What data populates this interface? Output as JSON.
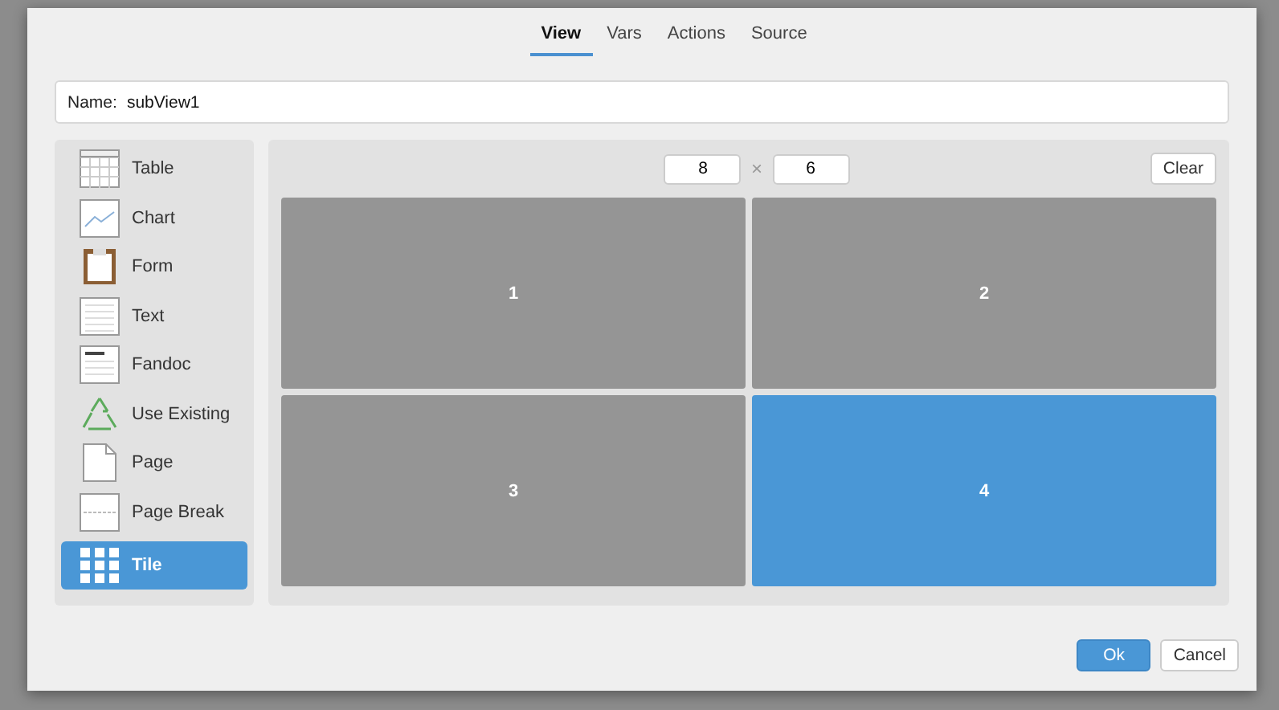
{
  "tabs": [
    {
      "label": "View",
      "selected": true
    },
    {
      "label": "Vars",
      "selected": false
    },
    {
      "label": "Actions",
      "selected": false
    },
    {
      "label": "Source",
      "selected": false
    }
  ],
  "name_field": {
    "label": "Name:",
    "value": "subView1"
  },
  "palette": [
    {
      "label": "Table",
      "kind": "table",
      "selected": false
    },
    {
      "label": "Chart",
      "kind": "chart",
      "selected": false
    },
    {
      "label": "Form",
      "kind": "form",
      "selected": false
    },
    {
      "label": "Text",
      "kind": "text",
      "selected": false
    },
    {
      "label": "Fandoc",
      "kind": "fandoc",
      "selected": false
    },
    {
      "label": "Use Existing",
      "kind": "recycle",
      "selected": false
    },
    {
      "label": "Page",
      "kind": "page",
      "selected": false
    },
    {
      "label": "Page Break",
      "kind": "pagebreak",
      "selected": false
    },
    {
      "label": "Tile",
      "kind": "tile",
      "selected": true
    }
  ],
  "grid_size": {
    "columns": "8",
    "times": "×",
    "rows": "6"
  },
  "clear_button": "Clear",
  "tiles": [
    {
      "label": "1",
      "selected": false
    },
    {
      "label": "2",
      "selected": false
    },
    {
      "label": "3",
      "selected": false
    },
    {
      "label": "4",
      "selected": true
    }
  ],
  "buttons": [
    {
      "label": "Ok",
      "kind": "primary"
    },
    {
      "label": "Cancel",
      "kind": "default"
    }
  ]
}
